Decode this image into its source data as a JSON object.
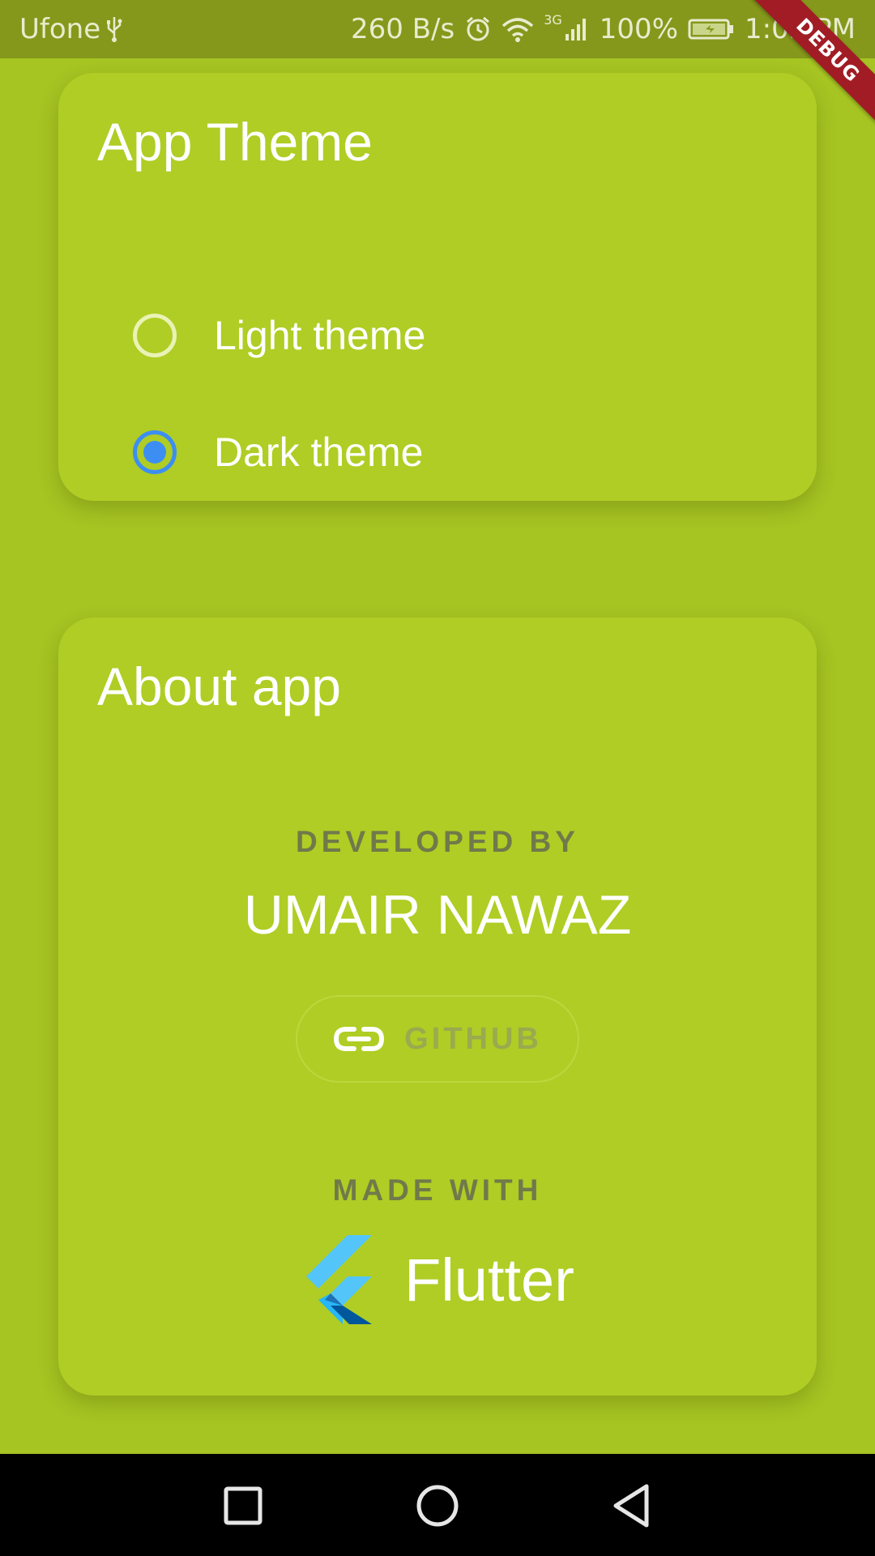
{
  "status_bar": {
    "carrier": "Ufone",
    "net_speed": "260 B/s",
    "network_type": "3G",
    "battery": "100%",
    "time": "1:05 PM",
    "debug_banner": "DEBUG"
  },
  "theme_card": {
    "title": "App Theme",
    "options": [
      {
        "label": "Light theme",
        "selected": false
      },
      {
        "label": "Dark theme",
        "selected": true
      }
    ]
  },
  "about_card": {
    "title": "About app",
    "developed_by_label": "DEVELOPED BY",
    "developer_name": "UMAIR NAWAZ",
    "github_button_label": "GITHUB",
    "github_icon": "link-icon",
    "made_with_label": "MADE WITH",
    "framework_name": "Flutter",
    "framework_icon": "flutter-logo-icon"
  },
  "nav_bar": {
    "buttons": [
      "recents-icon",
      "home-icon",
      "back-icon"
    ]
  },
  "colors": {
    "background": "#a6c422",
    "card": "#afcd24",
    "status_bar": "#86981b",
    "radio_selected": "#3d8ef2",
    "debug_ribbon": "#a11c24"
  }
}
